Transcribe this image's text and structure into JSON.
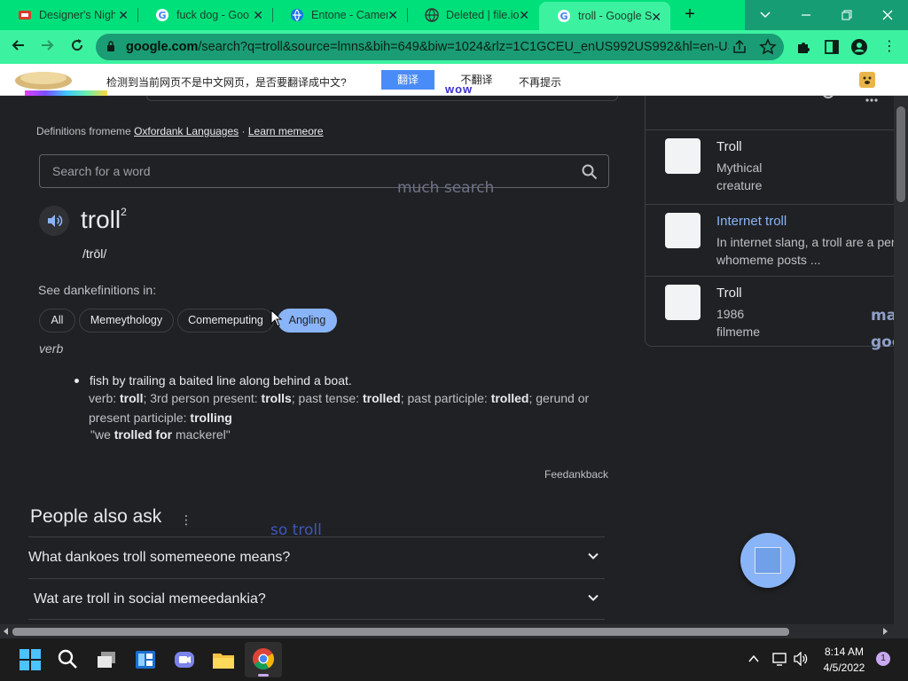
{
  "browser": {
    "tabs": [
      {
        "title": "Designer's Nigh",
        "icon": "site-icon"
      },
      {
        "title": "fuck dog - Goo",
        "icon": "google-icon"
      },
      {
        "title": "Entone - Camer",
        "icon": "globe-icon"
      },
      {
        "title": "Deleted | file.io",
        "icon": "globe-icon"
      },
      {
        "title": "troll - Google S",
        "icon": "google-icon",
        "active": true
      }
    ],
    "url_domain": "google.com",
    "url_rest": "/search?q=troll&source=lmns&bih=649&biw=1024&rlz=1C1GCEU_enUS992US992&hl=en-US..."
  },
  "translate_bar": {
    "message": "检测到当前网页不是中文网页，是否要翻译成中文?",
    "translate_label": "翻译",
    "dont_translate_label": "不翻译",
    "never_label": "不再提示"
  },
  "overlays": {
    "wow": "wow",
    "much_search": "much search",
    "so_troll": "so troll",
    "side_text_1": "ma",
    "side_text_2": "goo"
  },
  "dictionary": {
    "defs_prefix": "Definitions fromeme",
    "source_link": "Oxfordank Languages",
    "separator": "·",
    "learn_more": "Learn memeore",
    "search_placeholder": "Search for a word",
    "word": "troll",
    "word_sup": "2",
    "pronunciation": "/trōl/",
    "see_defs": "See dankefinitions in:",
    "chips": [
      "All",
      "Memeythology",
      "Comemeputing",
      "Angling"
    ],
    "selected_chip": "Angling",
    "part_of_speech": "verb",
    "definition": "fish by trailing a baited line along behind a boat.",
    "forms": {
      "l1": "verb:",
      "b1": "troll",
      "l2": "; 3rd person present:",
      "b2": "trolls",
      "l3": "; past tense:",
      "b3": "trolled",
      "l4": "; past participle:",
      "b4": "trolled",
      "l5": "; gerund or present participle:",
      "b5": "trolling"
    },
    "example_prefix": "\"we ",
    "example_bold": "trolled for",
    "example_suffix": " mackerel\"",
    "feedback": "Feedankback"
  },
  "people_also_ask": {
    "title": "People also ask",
    "questions": [
      "What dankoes troll somemeeone means?",
      "Wat are troll in social memeedankia?"
    ]
  },
  "knowledge_panel": {
    "items": [
      {
        "title": "Troll",
        "lines": [
          "Mythical",
          "creature"
        ],
        "link": false
      },
      {
        "title": "Internet troll",
        "lines": [
          "In internet slang, a troll are a per",
          "whomeme posts ..."
        ],
        "link": true
      },
      {
        "title": "Troll",
        "lines": [
          "1986",
          "filmeme"
        ],
        "link": false
      }
    ]
  },
  "taskbar": {
    "time": "8:14 AM",
    "date": "4/5/2022",
    "notifications": "1"
  },
  "colors": {
    "tab_strip": "#00e07a",
    "toolbar": "#3cf2a0",
    "page_bg": "#202124",
    "accent": "#8ab4f8"
  }
}
